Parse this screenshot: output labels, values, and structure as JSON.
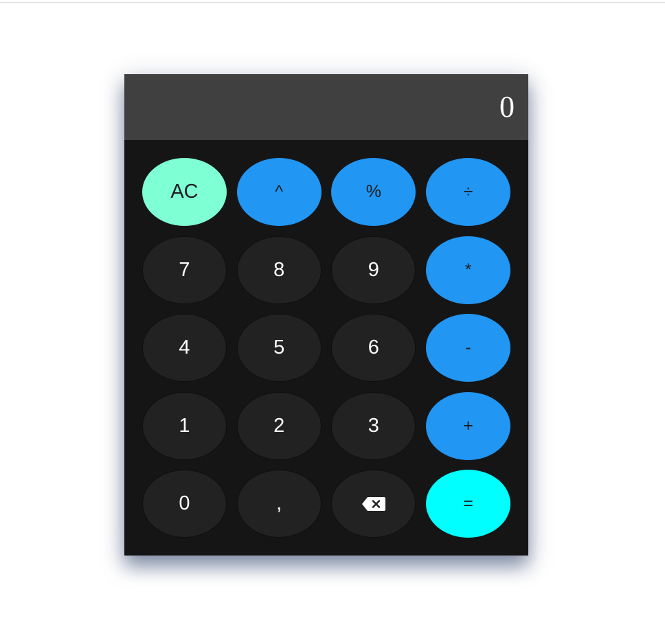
{
  "display": {
    "value": "0"
  },
  "keys": {
    "clear": "AC",
    "power": "^",
    "percent": "%",
    "divide": "÷",
    "seven": "7",
    "eight": "8",
    "nine": "9",
    "multiply": "*",
    "four": "4",
    "five": "5",
    "six": "6",
    "subtract": "-",
    "one": "1",
    "two": "2",
    "three": "3",
    "add": "+",
    "zero": "0",
    "decimal": ",",
    "backspace_icon": "backspace-icon",
    "equals": "="
  },
  "colors": {
    "display_bg": "#404040",
    "body_bg": "#161516",
    "number_key": "#232222",
    "operator_key": "#2196f3",
    "clear_key": "#7fffd4",
    "equals_key": "#00ffff"
  }
}
